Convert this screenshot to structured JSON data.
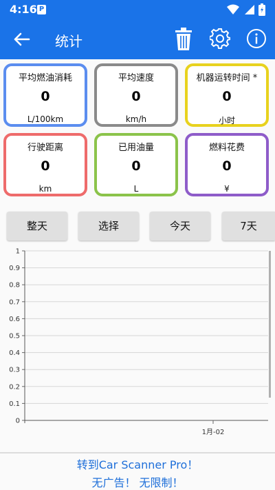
{
  "status_bar": {
    "time": "4:16",
    "badge": "P"
  },
  "app_bar": {
    "title": "统计"
  },
  "cards": [
    {
      "label": "平均燃油消耗",
      "value": "0",
      "unit": "L/100km",
      "color": "#5b8def"
    },
    {
      "label": "平均速度",
      "value": "0",
      "unit": "km/h",
      "color": "#8a8a8a"
    },
    {
      "label": "机器运转时间 *",
      "value": "0",
      "unit": "小时",
      "color": "#e8d21e"
    },
    {
      "label": "行驶距离",
      "value": "0",
      "unit": "km",
      "color": "#ee6b6b"
    },
    {
      "label": "已用油量",
      "value": "0",
      "unit": "L",
      "color": "#8bc34a"
    },
    {
      "label": "燃料花费",
      "value": "0",
      "unit": "¥",
      "color": "#8e5cc9"
    }
  ],
  "range_buttons": [
    "整天",
    "选择",
    "今天",
    "7天"
  ],
  "chart_data": {
    "type": "line",
    "ylim": [
      0,
      1
    ],
    "yticks": [
      "1",
      "0.9",
      "0.8",
      "0.7",
      "0.6",
      "0.5",
      "0.4",
      "0.3",
      "0.2",
      "0.1",
      "0"
    ],
    "x": [
      "1月-02"
    ],
    "series": [
      {
        "values": []
      }
    ]
  },
  "promo": {
    "line1": "转到Car Scanner Pro！",
    "line2": "无广告！ 无限制！"
  },
  "colors": {
    "primary": "#1a73e8",
    "promo_text": "#1e6fd9"
  }
}
